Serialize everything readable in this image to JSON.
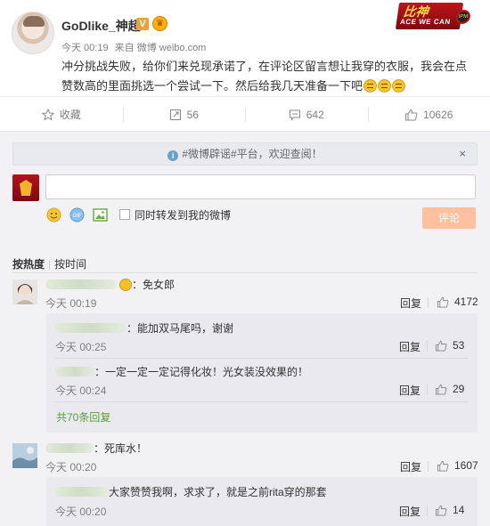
{
  "post": {
    "username": "GoDlike_神超",
    "verified_badge": "V",
    "crown_badge_icon": "crown-badge-icon",
    "brand_logo": {
      "line1": "比神",
      "line2": "ACE WE CAN",
      "badge": "IPM"
    },
    "meta": {
      "time": "今天 00:19",
      "source": "来自 微博 weibo.com"
    },
    "text": "冲分挑战失败，给你们来兑现承诺了，在评论区留言想让我穿的衣服，我会在点赞数高的里面挑选一个尝试一下。然后给我几天准备一下吧"
  },
  "actions": {
    "favorite_label": "收藏",
    "repost_count": "56",
    "comment_count": "642",
    "like_count": "10626"
  },
  "notice": {
    "text": "#微博辟谣#平台，欢迎查阅！",
    "close": "×"
  },
  "composer": {
    "repost_also_label": "同时转发到我的微博",
    "submit_label": "评论"
  },
  "sort": {
    "hot": "按热度",
    "time": "按时间"
  },
  "comments": [
    {
      "text": "：免女郎",
      "time": "今天 00:19",
      "reply": "回复",
      "likes": "4172",
      "subs": [
        {
          "text": "：能加双马尾吗，谢谢",
          "time": "今天 00:25",
          "reply": "回复",
          "likes": "53"
        },
        {
          "text": "：一定一定一定记得化妆！光女装没效果的！",
          "time": "今天 00:24",
          "reply": "回复",
          "likes": "29"
        }
      ],
      "more": "共70条回复"
    },
    {
      "text": "：死库水！",
      "time": "今天 00:20",
      "reply": "回复",
      "likes": "1607",
      "subs": [
        {
          "text": "大家赞赞我啊，求求了，就是之前rita穿的那套",
          "time": "今天 00:20",
          "reply": "回复",
          "likes": "14"
        }
      ]
    }
  ],
  "colors": {
    "accent_orange": "#ff8140",
    "link_green": "#5a9e3f",
    "muted": "#808080"
  }
}
